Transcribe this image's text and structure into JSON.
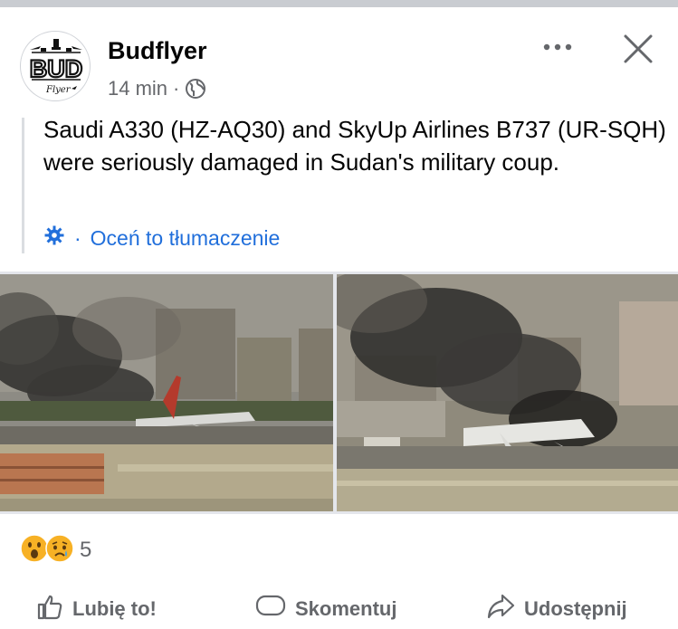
{
  "post": {
    "author": "Budflyer",
    "time": "14 min",
    "separator": "·",
    "visibility_icon": "globe-icon",
    "text": "Saudi A330 (HZ-AQ30) and SkyUp Airlines B737 (UR-SQH) were seriously damaged in Sudan's military coup.",
    "translation": {
      "gear_icon": "gear-icon",
      "separator": "·",
      "rate_label": "Oceń to tłumaczenie"
    },
    "avatar_logo": {
      "text": "BUD",
      "subtext": "Flyer"
    }
  },
  "reactions": {
    "icons": [
      "wow-reaction-icon",
      "sad-reaction-icon"
    ],
    "count": "5"
  },
  "actions": {
    "like": "Lubię to!",
    "comment": "Skomentuj",
    "share": "Udostępnij"
  },
  "colors": {
    "link_blue": "#216fdb",
    "secondary_text": "#65676b",
    "reaction_yellow": "#f7b125"
  }
}
